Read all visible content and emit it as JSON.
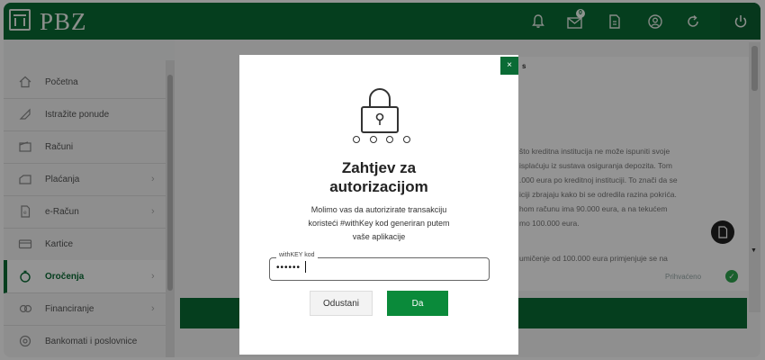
{
  "header": {
    "brand": "PBZ",
    "message_badge": "0",
    "icons": [
      "bank-logo-icon",
      "bell-icon",
      "mail-icon",
      "document-icon",
      "user-icon",
      "refresh-icon",
      "power-icon"
    ]
  },
  "sidebar": {
    "items": [
      {
        "label": "Početna",
        "icon": "home-icon",
        "chevron": ""
      },
      {
        "label": "Istražite ponude",
        "icon": "tag-icon",
        "chevron": ""
      },
      {
        "label": "Računi",
        "icon": "wallet-icon",
        "chevron": ""
      },
      {
        "label": "Plaćanja",
        "icon": "payment-icon",
        "chevron": "›"
      },
      {
        "label": "e-Račun",
        "icon": "e-invoice-icon",
        "chevron": "›"
      },
      {
        "label": "Kartice",
        "icon": "card-icon",
        "chevron": ""
      },
      {
        "label": "Oročenja",
        "icon": "deposit-icon",
        "chevron": "›"
      },
      {
        "label": "Financiranje",
        "icon": "financing-icon",
        "chevron": "›"
      },
      {
        "label": "Bankomati i poslovnice",
        "icon": "location-icon",
        "chevron": ""
      }
    ]
  },
  "background": {
    "section_title": "s",
    "info_lines": [
      "što kreditna institucija ne može ispuniti svoje",
      "isplaćuju iz sustava osiguranja depozita. Tom",
      ".000 eura po kreditnoj instituciji. To znači da se",
      "iciji zbrajaju kako bi se odredila razina pokrića.",
      "hom računu ima 90.000 eura, a na tekućem",
      "mo 100.000 eura."
    ],
    "partial_line": "umičenje od 100.000 eura primjenjuje se na",
    "accepted_label": "Prihvaćeno"
  },
  "modal": {
    "close_label": "×",
    "title_line1": "Zahtjev za",
    "title_line2": "autorizacijom",
    "desc_line1": "Molimo vas da autorizirate transakciju",
    "desc_line2": "koristeći #withKey kod generiran putem",
    "desc_line3": "vaše aplikacije",
    "field_label": "withKEY kod",
    "field_value": "••••••",
    "cancel_label": "Odustani",
    "confirm_label": "Da"
  },
  "colors": {
    "brand_green": "#0a6b35",
    "confirm_green": "#0a8a3a",
    "accepted_check": "#2ea44f"
  }
}
